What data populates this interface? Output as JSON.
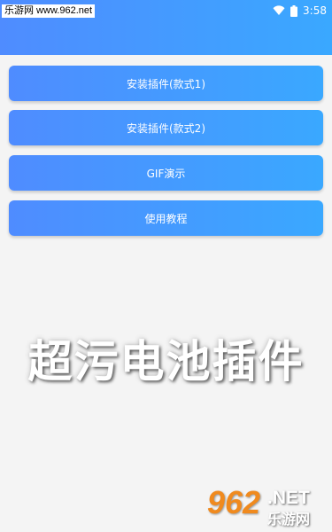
{
  "status_bar": {
    "watermark_text": "乐游网 www.962.net",
    "time": "3:58",
    "icons": [
      "wifi-icon",
      "battery-icon"
    ]
  },
  "buttons": [
    {
      "label": "安装插件(款式1)"
    },
    {
      "label": "安装插件(款式2)"
    },
    {
      "label": "GIF演示"
    },
    {
      "label": "使用教程"
    }
  ],
  "title": "超污电池插件",
  "watermark": {
    "number": "962",
    "net": ".NET",
    "site_name": "乐游网"
  },
  "colors": {
    "accent_start": "#4f8cff",
    "accent_end": "#3aa8ff",
    "background": "#f4f4f4",
    "watermark_orange": "#f08a1e"
  }
}
